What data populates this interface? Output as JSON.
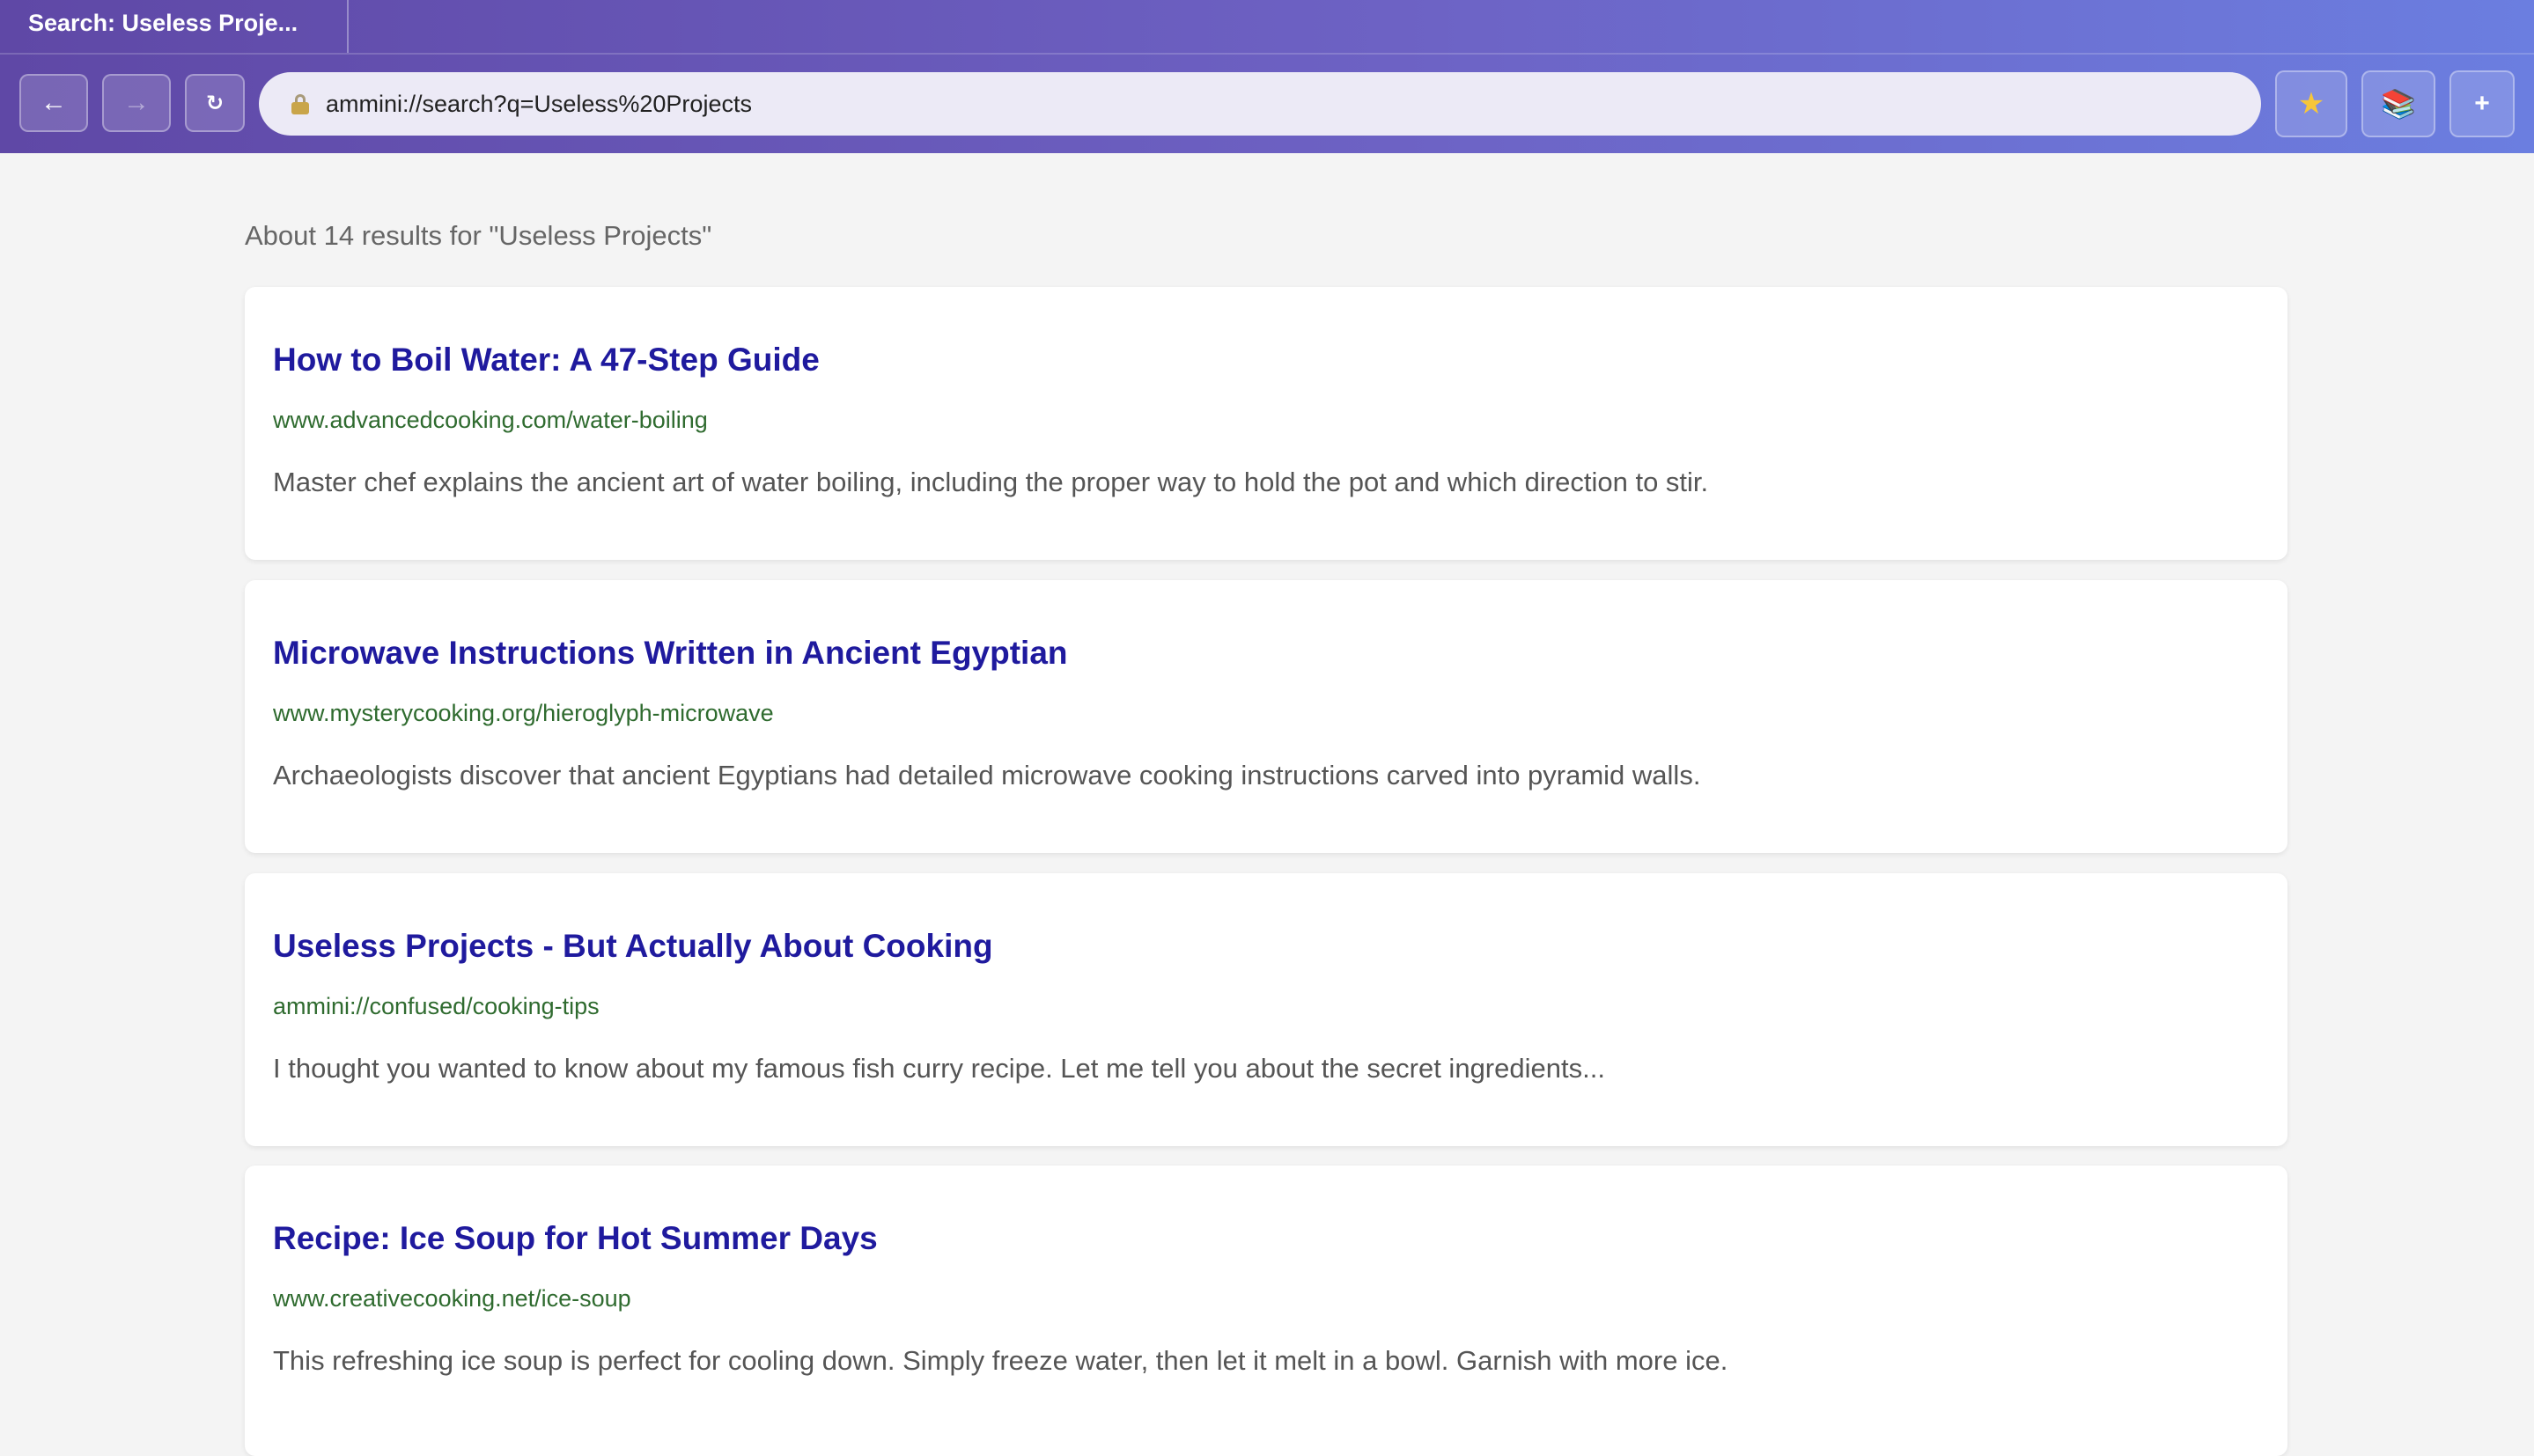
{
  "browser": {
    "tab_title": "Search: Useless Proje...",
    "url": "ammini://search?q=Useless%20Projects",
    "back_label": "←",
    "forward_label": "→",
    "reload_label": "↻",
    "bookmark_label": "★",
    "library_label": "📚",
    "new_tab_label": "+"
  },
  "search": {
    "result_count_text": "About 14 results for \"Useless Projects\"",
    "results": [
      {
        "title": "How to Boil Water: A 47-Step Guide",
        "url": "www.advancedcooking.com/water-boiling",
        "snippet": "Master chef explains the ancient art of water boiling, including the proper way to hold the pot and which direction to stir."
      },
      {
        "title": "Microwave Instructions Written in Ancient Egyptian",
        "url": "www.mysterycooking.org/hieroglyph-microwave",
        "snippet": "Archaeologists discover that ancient Egyptians had detailed microwave cooking instructions carved into pyramid walls."
      },
      {
        "title": "Useless Projects - But Actually About Cooking",
        "url": "ammini://confused/cooking-tips",
        "snippet": "I thought you wanted to know about my famous fish curry recipe. Let me tell you about the secret ingredients..."
      },
      {
        "title": "Recipe: Ice Soup for Hot Summer Days",
        "url": "www.creativecooking.net/ice-soup",
        "snippet": "This refreshing ice soup is perfect for cooling down. Simply freeze water, then let it melt in a bowl. Garnish with more ice."
      }
    ]
  }
}
